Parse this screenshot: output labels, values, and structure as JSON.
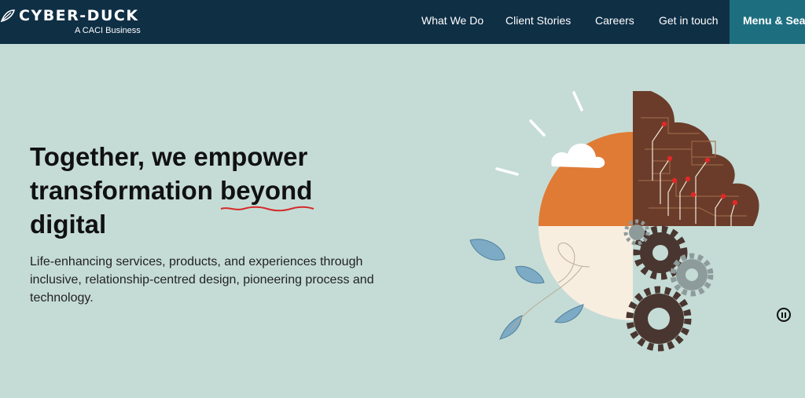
{
  "brand": {
    "name": "CYBER-DUCK",
    "tagline": "A CACI Business"
  },
  "nav": {
    "items": [
      "What We Do",
      "Client Stories",
      "Careers",
      "Get in touch"
    ],
    "menu_label": "Menu & Search"
  },
  "hero": {
    "title_part1": "Together, we empower transformation ",
    "title_highlight": "beyond",
    "title_part2": " digital",
    "description": "Life-enhancing services, products, and experiences through inclusive, relationship-centred design, pioneering process and technology."
  },
  "colors": {
    "header_bg": "#0f2f45",
    "menu_bg": "#1d6f80",
    "page_bg": "#c5dcd6",
    "accent_orange": "#e07b35",
    "accent_red": "#d42a2a"
  },
  "icons": {
    "logo": "duck-feather-icon",
    "carousel_control": "pause-icon"
  }
}
